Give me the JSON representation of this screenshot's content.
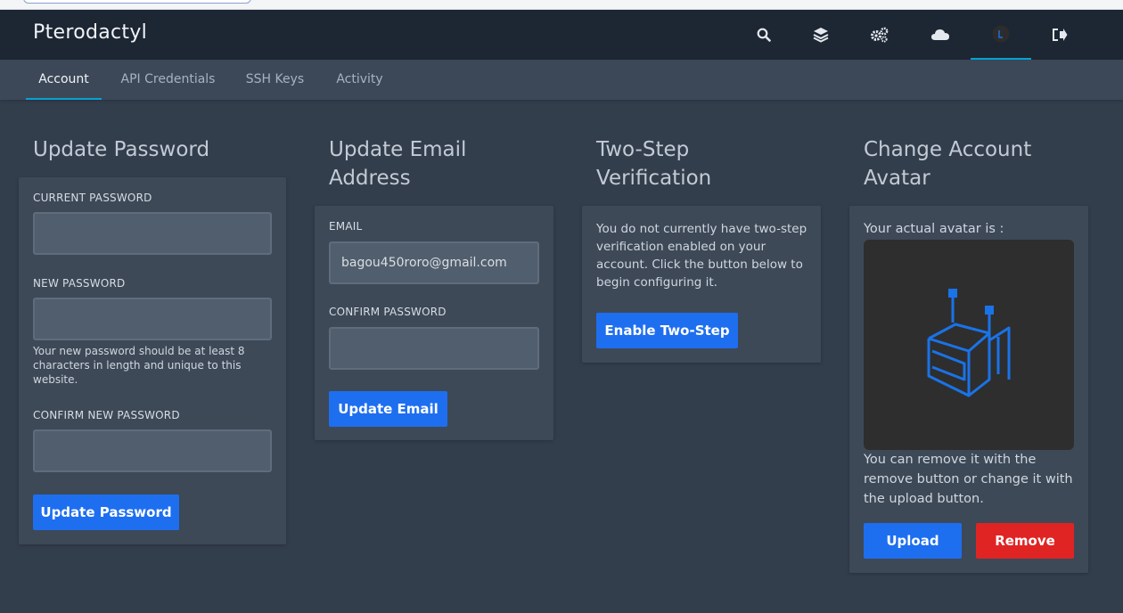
{
  "app": {
    "brand": "Pterodactyl"
  },
  "topnav": {
    "items": [
      {
        "icon": "search-icon"
      },
      {
        "icon": "layers-icon"
      },
      {
        "icon": "cogs-icon"
      },
      {
        "icon": "cloud-icon"
      },
      {
        "icon": "avatar-icon",
        "active": true
      },
      {
        "icon": "logout-icon"
      }
    ]
  },
  "subnav": {
    "tabs": [
      {
        "label": "Account",
        "active": true
      },
      {
        "label": "API Credentials"
      },
      {
        "label": "SSH Keys"
      },
      {
        "label": "Activity"
      }
    ]
  },
  "password": {
    "title": "Update Password",
    "current_label": "CURRENT PASSWORD",
    "current_value": "",
    "new_label": "NEW PASSWORD",
    "new_value": "",
    "hint": "Your new password should be at least 8 characters in length and unique to this website.",
    "confirm_label": "CONFIRM NEW PASSWORD",
    "confirm_value": "",
    "button": "Update Password"
  },
  "email": {
    "title": "Update Email Address",
    "email_label": "EMAIL",
    "email_value": "bagou450roro@gmail.com",
    "confirm_label": "CONFIRM PASSWORD",
    "confirm_value": "",
    "button": "Update Email"
  },
  "twostep": {
    "title": "Two-Step Verification",
    "text": "You do not currently have two-step verification enabled on your account. Click the button below to begin configuring it.",
    "button": "Enable Two-Step"
  },
  "avatar": {
    "title": "Change Account Avatar",
    "intro": "Your actual avatar is :",
    "help": "You can remove it with the remove button or change it with the upload button.",
    "upload_button": "Upload",
    "remove_button": "Remove"
  },
  "colors": {
    "accent": "#06a3d1",
    "primary_button": "#1e6ef0",
    "danger_button": "#e02424",
    "avatar_logo": "#1a73e8"
  }
}
